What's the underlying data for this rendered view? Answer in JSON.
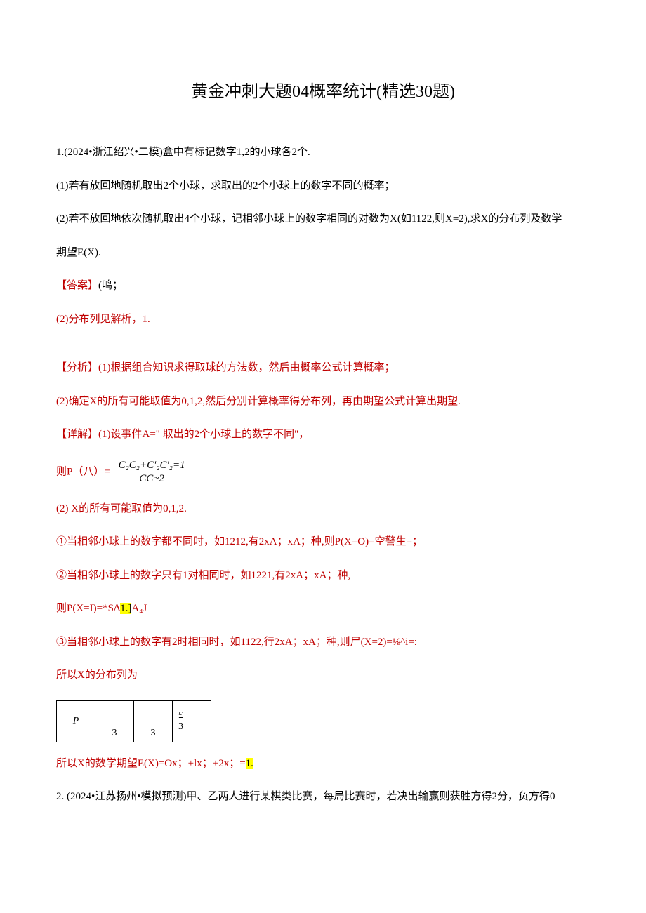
{
  "title": "黄金冲刺大题04概率统计(精选30题)",
  "p1": "1.(2024•浙江绍兴•二模)盒中有标记数字1,2的小球各2个.",
  "p2": "(1)若有放回地随机取出2个小球，求取出的2个小球上的数字不同的概率；",
  "p3": "(2)若不放回地依次随机取出4个小球，记相邻小球上的数字相同的对数为X(如1122,则X=2),求X的分布列及数学",
  "p3b": "期望E(X).",
  "ans_label": "【答案】",
  "ans_1": "(鸣；",
  "ans_2": "(2)分布列见解析，1.",
  "ana_label": "【分析】",
  "ana_1": "(1)根据组合知识求得取球的方法数，然后由概率公式计算概率；",
  "ana_2": "(2)确定X的所有可能取值为0,1,2,然后分别计算概率得分布列，再由期望公式计算出期望.",
  "det_label": "【详解】",
  "det_1": "(1)设事件A=\" 取出的2个小球上的数字不同\"，",
  "det_p_prefix": "则P（八）=",
  "frac_num": "C₂C₂+C'₂C'₂=1",
  "frac_den": "CC~2",
  "det2_1": "(2)",
  "det2_1b": " X的所有可能取值为0,1,2.",
  "c1": "①当相邻小球上的数字都不同时，如1212,有2xA；xA；种,则P(X=O)=空警生=；",
  "c2": "②当相邻小球上的数字只有1对相同时，如1221,有2xA；xA；种,",
  "c2b_a": "则P(X=I)=*S∆",
  "c2b_hl": "1.]",
  "c2b_b": "A₄J",
  "c3": "③当相邻小球上的数字有2时相同时，如1122,行2xA；xA；种,则尸(X=2)=⅛^i=:",
  "dist_t": "所以X的分布列为",
  "tbl": {
    "r0c0": "P",
    "r0c1": "3",
    "r0c2": "3",
    "r0c3_top": "£",
    "r0c3_bot": "3"
  },
  "exp_a": "所以X的数学期望E(X)=Ox；+lx；+2x；=",
  "exp_hl": "1.",
  "q2": "2. (2024•江苏扬州•模拟预测)甲、乙两人进行某棋类比赛，每局比赛时，若决出输赢则获胜方得2分，负方得0"
}
